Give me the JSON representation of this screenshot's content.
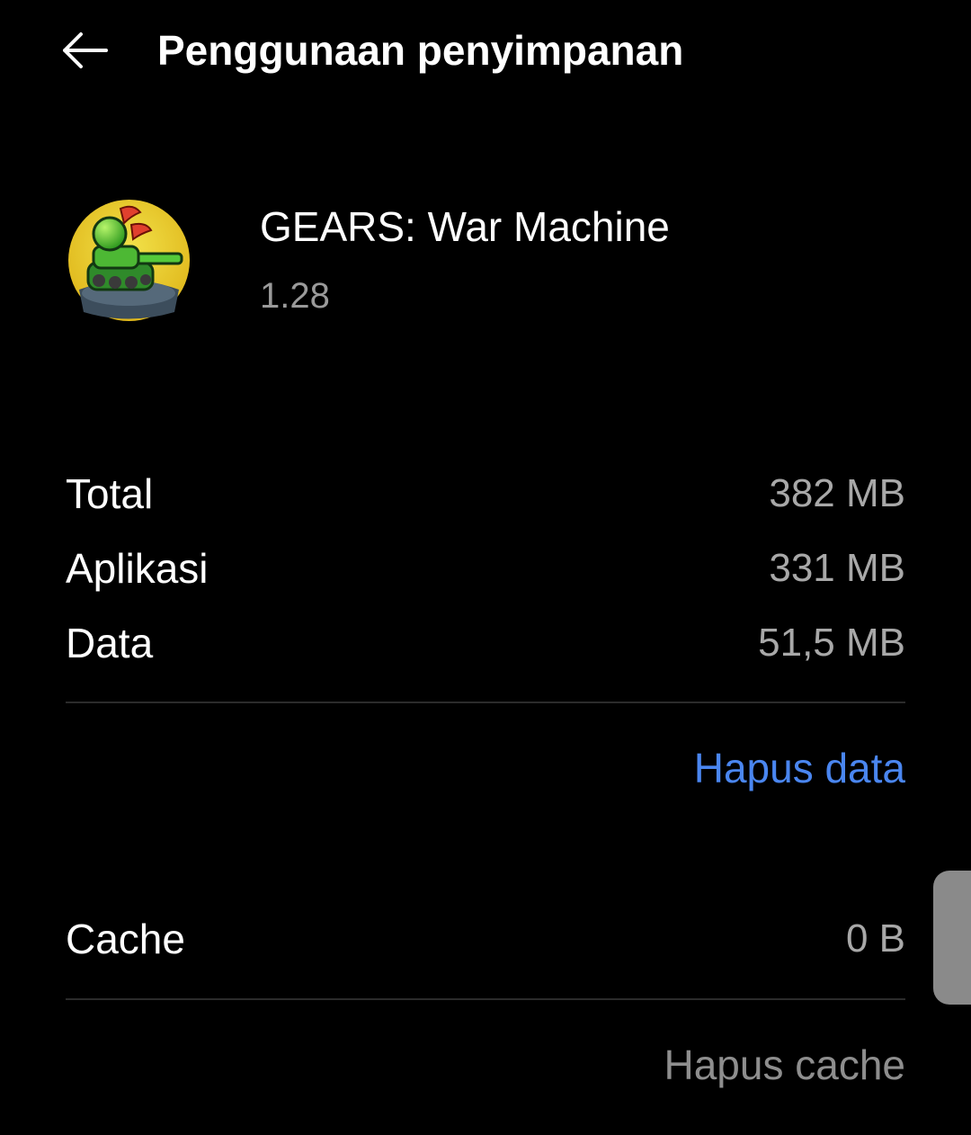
{
  "header": {
    "title": "Penggunaan penyimpanan",
    "back_icon": "back-arrow-icon"
  },
  "app": {
    "name": "GEARS: War Machine",
    "version": "1.28",
    "icon": "game-tank-icon"
  },
  "storage": {
    "rows": [
      {
        "label": "Total",
        "value": "382 MB"
      },
      {
        "label": "Aplikasi",
        "value": "331 MB"
      },
      {
        "label": "Data",
        "value": "51,5 MB"
      }
    ],
    "clear_data_label": "Hapus data"
  },
  "cache": {
    "label": "Cache",
    "value": "0 B",
    "clear_cache_label": "Hapus cache"
  },
  "colors": {
    "background": "#000000",
    "accent_blue": "#4a86f0",
    "secondary_text": "#a8a8a8",
    "disabled_text": "#8e8e8e"
  }
}
